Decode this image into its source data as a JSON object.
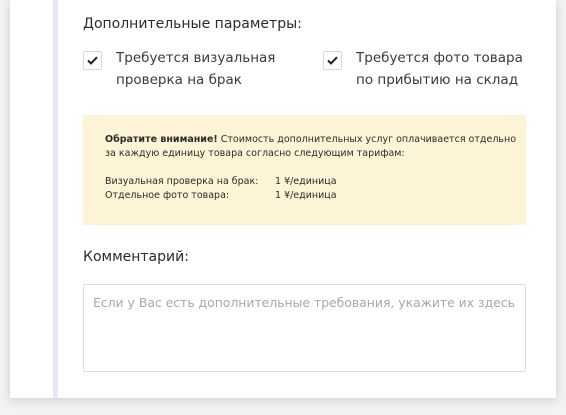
{
  "params": {
    "title": "Дополнительные параметры:",
    "options": [
      {
        "line1": "Требуется визуальная",
        "line2": "проверка на брак",
        "checked": true
      },
      {
        "line1": "Требуется фото товара",
        "line2": "по прибытию на склад",
        "checked": true
      }
    ]
  },
  "notice": {
    "bold": "Обратите внимание!",
    "text_line1": " Стоимость дополнительных услуг оплачивается отдельно",
    "text_line2": "за каждую единицу товара согласно следующим тарифам:",
    "tariffs": [
      {
        "name": "Визуальная проверка на брак:",
        "price": "1 ¥/единица"
      },
      {
        "name": "Отдельное фото товара:",
        "price": "1 ¥/единица"
      }
    ]
  },
  "comment": {
    "title": "Комментарий:",
    "value": "",
    "placeholder": "Если у Вас есть дополнительные требования, укажите их здесь"
  }
}
